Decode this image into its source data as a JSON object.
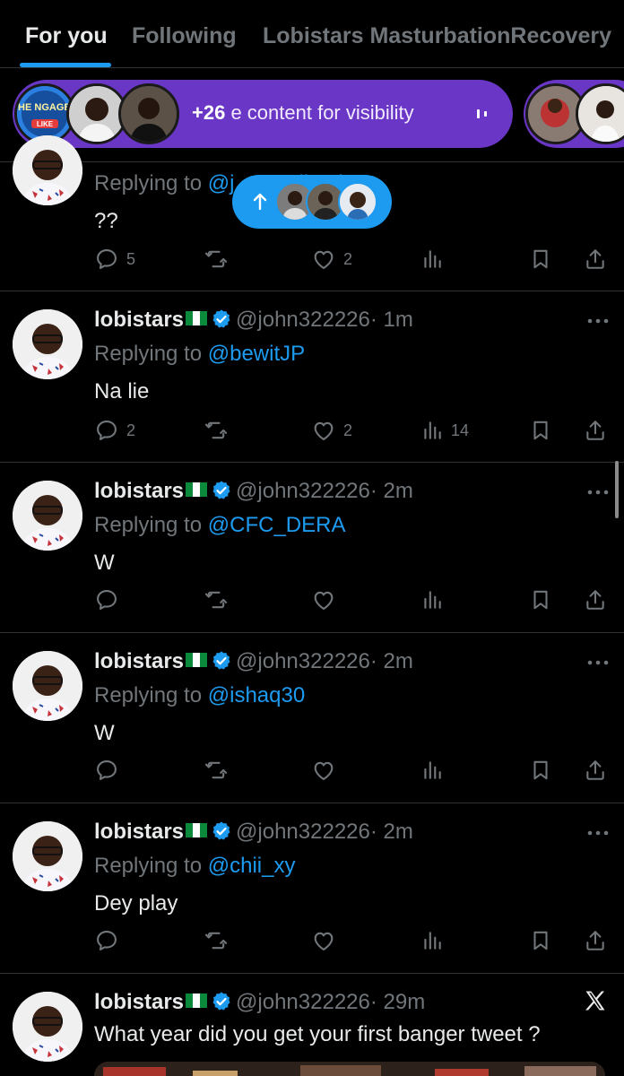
{
  "tabs": [
    {
      "label": "For you",
      "active": true
    },
    {
      "label": "Following",
      "active": false
    },
    {
      "label": "Lobistars MasturbationRecovery",
      "active": false
    }
  ],
  "promo": {
    "logo_text": "THE NGAGER",
    "logo_sub": "LIKE",
    "count": "+26",
    "text": "e content for visibility"
  },
  "new_posts_pill": {
    "arrow": "↑"
  },
  "posts": [
    {
      "reply_prefix": "Replying to ",
      "reply_to": "@j... Muslimah",
      "text": "??",
      "replies": "5",
      "reposts": "",
      "likes": "2",
      "views": ""
    },
    {
      "name": "lobistars",
      "handle": "@john322226",
      "time": "· 1m",
      "reply_prefix": "Replying to ",
      "reply_to": "@bewitJP",
      "text": "Na lie",
      "replies": "2",
      "reposts": "",
      "likes": "2",
      "views": "14"
    },
    {
      "name": "lobistars",
      "handle": "@john322226",
      "time": "· 2m",
      "reply_prefix": "Replying to ",
      "reply_to": "@CFC_DERA",
      "text": "W",
      "replies": "",
      "reposts": "",
      "likes": "",
      "views": ""
    },
    {
      "name": "lobistars",
      "handle": "@john322226",
      "time": "· 2m",
      "reply_prefix": "Replying to ",
      "reply_to": "@ishaq30",
      "text": "W",
      "replies": "",
      "reposts": "",
      "likes": "",
      "views": ""
    },
    {
      "name": "lobistars",
      "handle": "@john322226",
      "time": "· 2m",
      "reply_prefix": "Replying to ",
      "reply_to": "@chii_xy",
      "text": "Dey play",
      "replies": "",
      "reposts": "",
      "likes": "",
      "views": ""
    },
    {
      "name": "lobistars",
      "handle": "@john322226",
      "time": "· 29m",
      "text": "What year did you get your first banger tweet ?"
    }
  ],
  "colors": {
    "accent": "#1d9bf0",
    "promo": "#6a36c6",
    "muted": "#71767b",
    "text": "#e7e9ea",
    "background": "#000000"
  },
  "icons": [
    "reply-icon",
    "repost-icon",
    "like-icon",
    "views-icon",
    "bookmark-icon",
    "share-icon",
    "verified-badge-icon",
    "more-icon",
    "x-logo-icon",
    "pause-icon",
    "arrow-up-icon"
  ]
}
